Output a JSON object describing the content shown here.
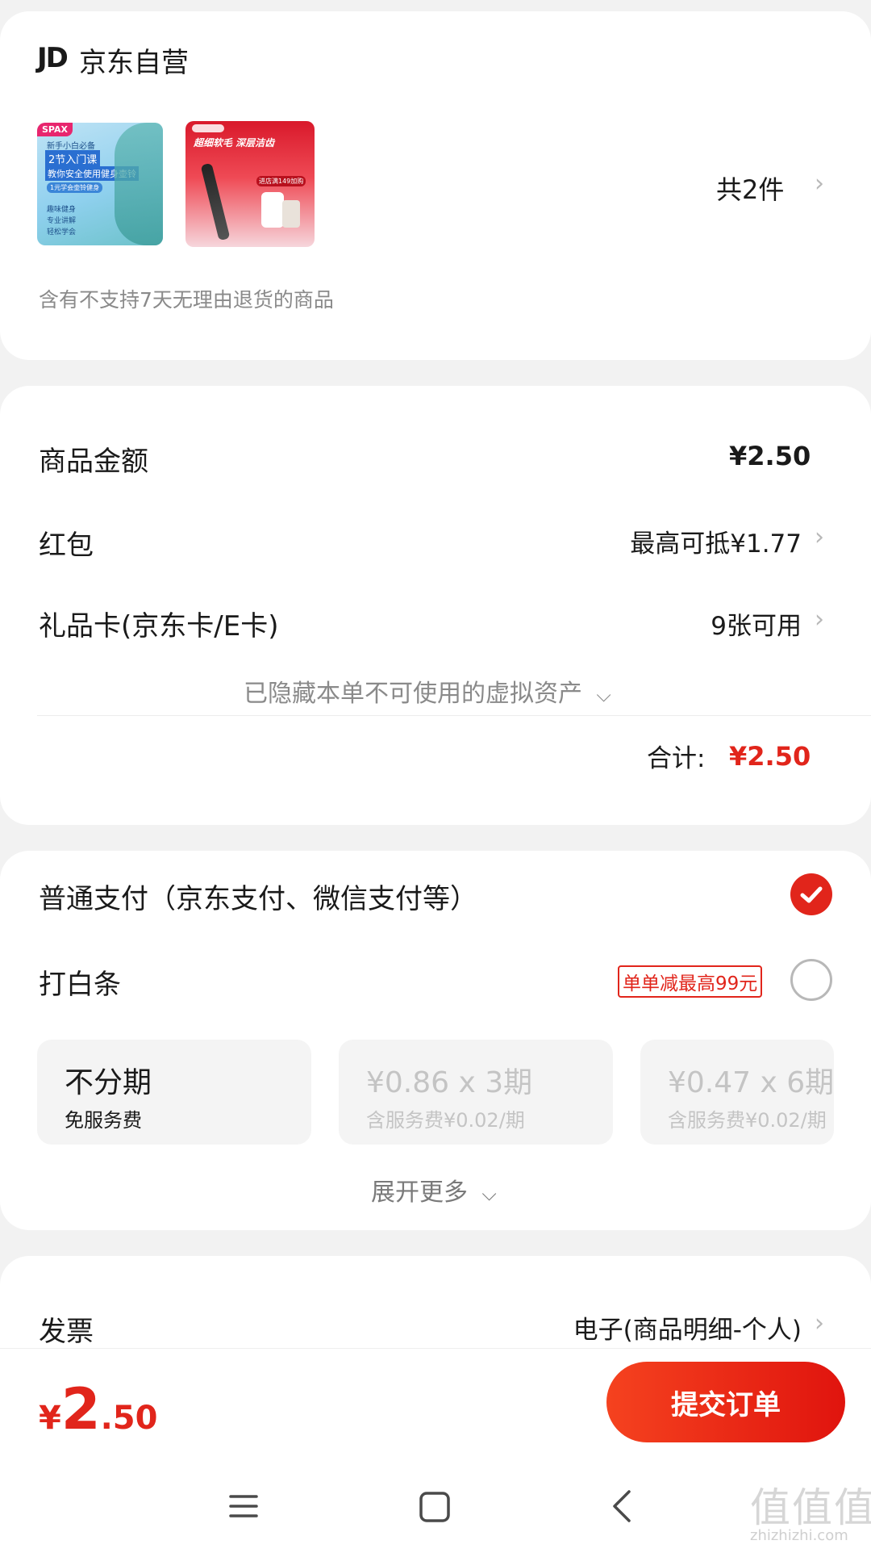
{
  "store": {
    "logo": "JD",
    "name": "京东自营",
    "count_label": "共2件",
    "return_notice": "含有不支持7天无理由退货的商品",
    "product1": {
      "badge": "SPAX",
      "line1": "新手小白必备",
      "line2": "2节入门课",
      "line3": "教你安全使用健身壶铃",
      "line4": "1元学会壶铃健身",
      "tags": [
        "趣味健身",
        "专业讲解",
        "轻松学会"
      ]
    },
    "product2": {
      "headline": "超细软毛 深层洁齿",
      "promo": "进店满149加购"
    }
  },
  "amounts": {
    "goods_label": "商品金额",
    "goods_value": "¥2.50",
    "redpack_label": "红包",
    "redpack_value": "最高可抵¥1.77",
    "giftcard_label": "礼品卡(京东卡/E卡)",
    "giftcard_value": "9张可用",
    "hidden_notice": "已隐藏本单不可使用的虚拟资产",
    "total_label": "合计:",
    "total_value": "¥2.50"
  },
  "payment": {
    "normal_label": "普通支付（京东支付、微信支付等）",
    "baitiao_label": "打白条",
    "baitiao_promo": "单单减最高99元",
    "plans": [
      {
        "title": "不分期",
        "sub": "免服务费"
      },
      {
        "title": "¥0.86 x 3期",
        "sub": "含服务费¥0.02/期"
      },
      {
        "title": "¥0.47 x 6期",
        "sub": "含服务费¥0.02/期"
      }
    ],
    "expand_label": "展开更多"
  },
  "invoice": {
    "label": "发票",
    "value": "电子(商品明细-个人)"
  },
  "bottom": {
    "currency": "¥",
    "price_int": "2",
    "price_dec": ".50",
    "submit_label": "提交订单"
  },
  "watermark": {
    "glyphs": "值值值",
    "site": "zhizhizhi.com"
  },
  "colors": {
    "accent": "#e1251b",
    "button_start": "#f5421f",
    "button_end": "#e0140e"
  }
}
